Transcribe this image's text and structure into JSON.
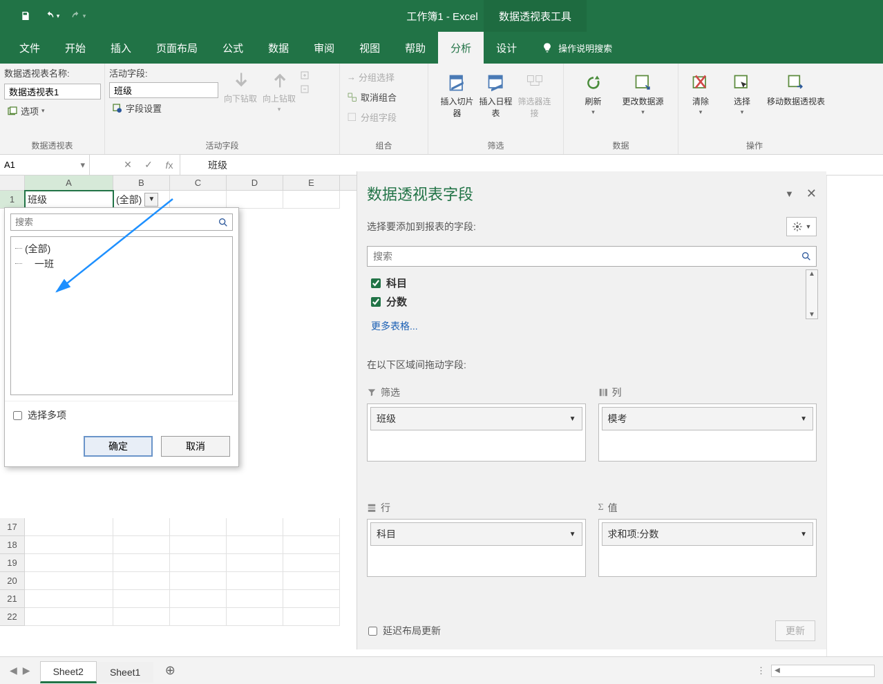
{
  "title": "工作簿1  -  Excel",
  "contextual_tab": "数据透视表工具",
  "tabs": [
    "文件",
    "开始",
    "插入",
    "页面布局",
    "公式",
    "数据",
    "审阅",
    "视图",
    "帮助",
    "分析",
    "设计"
  ],
  "active_tab": "分析",
  "tell_me": "操作说明搜索",
  "ribbon": {
    "pivot_name_label": "数据透视表名称:",
    "pivot_name_value": "数据透视表1",
    "options_label": "选项",
    "group1": "数据透视表",
    "active_field_label": "活动字段:",
    "active_field_value": "班级",
    "field_settings": "字段设置",
    "drill_down": "向下钻取",
    "drill_up": "向上钻取",
    "group2": "活动字段",
    "group_sel": "分组选择",
    "ungroup": "取消组合",
    "group_field": "分组字段",
    "group3": "组合",
    "slicer": "插入切片器",
    "timeline": "插入日程表",
    "filter_conn": "筛选器连接",
    "group4": "筛选",
    "refresh": "刷新",
    "change_src": "更改数据源",
    "group5": "数据",
    "clear": "清除",
    "select": "选择",
    "move": "移动数据透视表",
    "group6": "操作"
  },
  "name_box": "A1",
  "formula_value": "班级",
  "columns": [
    "A",
    "B",
    "C",
    "D",
    "E"
  ],
  "cell_a1": "班级",
  "cell_b1": "(全部)",
  "row_numbers_top": [
    "1"
  ],
  "row_numbers_bottom": [
    "17",
    "18",
    "19",
    "20",
    "21",
    "22"
  ],
  "filter_popup": {
    "search_placeholder": "搜索",
    "items": [
      "(全部)",
      "一班"
    ],
    "multi": "选择多项",
    "ok": "确定",
    "cancel": "取消"
  },
  "field_pane": {
    "title": "数据透视表字段",
    "choose_label": "选择要添加到报表的字段:",
    "search_placeholder": "搜索",
    "fields": [
      {
        "name": "科目",
        "checked": true
      },
      {
        "name": "分数",
        "checked": true
      }
    ],
    "more_tables": "更多表格...",
    "drag_label": "在以下区域间拖动字段:",
    "areas": {
      "filter": {
        "label": "筛选",
        "items": [
          "班级"
        ]
      },
      "columns": {
        "label": "列",
        "items": [
          "模考"
        ]
      },
      "rows": {
        "label": "行",
        "items": [
          "科目"
        ]
      },
      "values": {
        "label": "值",
        "items": [
          "求和项:分数"
        ]
      }
    },
    "defer": "延迟布局更新",
    "update": "更新"
  },
  "sheets": [
    "Sheet2",
    "Sheet1"
  ],
  "active_sheet": "Sheet2"
}
